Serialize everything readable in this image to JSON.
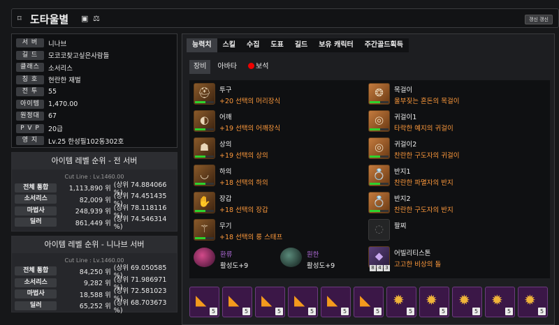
{
  "header": {
    "name": "도타울별",
    "update_label": "갱신 갱신"
  },
  "profile": [
    {
      "label": "서 버",
      "value": "니나브"
    },
    {
      "label": "길 드",
      "value": "모코코찾고싶은사람들"
    },
    {
      "label": "클래스",
      "value": "소서리스"
    },
    {
      "label": "칭 호",
      "value": "현란한 재벌"
    },
    {
      "label": "전 투",
      "value": "55"
    },
    {
      "label": "아이템",
      "value": "1,470.00"
    },
    {
      "label": "원정대",
      "value": "67"
    },
    {
      "label": "P V P",
      "value": "20급"
    },
    {
      "label": "영 지",
      "value": "Lv.25 한성필102동302호"
    }
  ],
  "rank_all": {
    "title": "아이템 레벨 순위 - 전 서버",
    "cutline": "Cut Line : Lv.1460.00",
    "rows": [
      {
        "label": "전체 통합",
        "rank": "1,113,890 위",
        "pct": "(상위 74.884066 %)"
      },
      {
        "label": "소서리스",
        "rank": "82,009 위",
        "pct": "(상위 74.451435 %)"
      },
      {
        "label": "마법사",
        "rank": "248,939 위",
        "pct": "(상위 78.118116 %)"
      },
      {
        "label": "딜러",
        "rank": "861,449 위",
        "pct": "(상위 74.546314 %)"
      }
    ]
  },
  "rank_server": {
    "title": "아이템 레벨 순위 - 니나브 서버",
    "cutline": "Cut Line : Lv.1460.00",
    "rows": [
      {
        "label": "전체 통합",
        "rank": "84,250 위",
        "pct": "(상위 69.050585 %)"
      },
      {
        "label": "소서리스",
        "rank": "9,282 위",
        "pct": "(상위 71.986971 %)"
      },
      {
        "label": "마법사",
        "rank": "18,588 위",
        "pct": "(상위 72.581023 %)"
      },
      {
        "label": "딜러",
        "rank": "65,252 위",
        "pct": "(상위 68.703673 %)"
      }
    ]
  },
  "tabs": [
    "능력치",
    "스킬",
    "수집",
    "도표",
    "길드",
    "보유 캐릭터",
    "주간골드획득"
  ],
  "subtabs": [
    "장비",
    "아바타",
    "보석"
  ],
  "equip_left": [
    {
      "name": "투구",
      "desc": "+20 선택의 머리장식",
      "quality": 0.55
    },
    {
      "name": "어깨",
      "desc": "+19 선택의 어깨장식",
      "quality": 0.55
    },
    {
      "name": "상의",
      "desc": "+19 선택의 상의",
      "quality": 0.55
    },
    {
      "name": "하의",
      "desc": "+18 선택의 하의",
      "quality": 0.55
    },
    {
      "name": "장갑",
      "desc": "+18 선택의 장갑",
      "quality": 0.55
    },
    {
      "name": "무기",
      "desc": "+18 선택의 룽 스태프",
      "quality": 0.55
    }
  ],
  "equip_right": [
    {
      "name": "목걸이",
      "desc": "울부짖는 혼돈의 목걸이",
      "quality": 0.55
    },
    {
      "name": "귀걸이1",
      "desc": "타락한 예지의 귀걸이",
      "quality": 0.55
    },
    {
      "name": "귀걸이2",
      "desc": "찬란한 구도자의 귀걸이",
      "quality": 0.55
    },
    {
      "name": "반지1",
      "desc": "찬란한 파멸자의 반지",
      "quality": 0.55
    },
    {
      "name": "반지2",
      "desc": "찬란한 구도자의 반지",
      "quality": 0.55
    },
    {
      "name": "팔찌",
      "desc": "",
      "quality": null
    }
  ],
  "stone": {
    "name": "어빌리티스톤",
    "desc": "고고한 비상의 돌",
    "chips": [
      "8",
      "4",
      "3"
    ]
  },
  "bracers": [
    {
      "name": "환류",
      "value": "활성도+9"
    },
    {
      "name": "원한",
      "value": "활성도+9"
    }
  ],
  "gems": [
    "5",
    "5",
    "5",
    "5",
    "5",
    "5",
    "5",
    "5",
    "5",
    "5",
    "5"
  ],
  "colors": {
    "accent": "#ff9a3c",
    "quality": "#2dd22d",
    "gem_bg": "#3b1747",
    "ancient": "#c47b3e"
  }
}
